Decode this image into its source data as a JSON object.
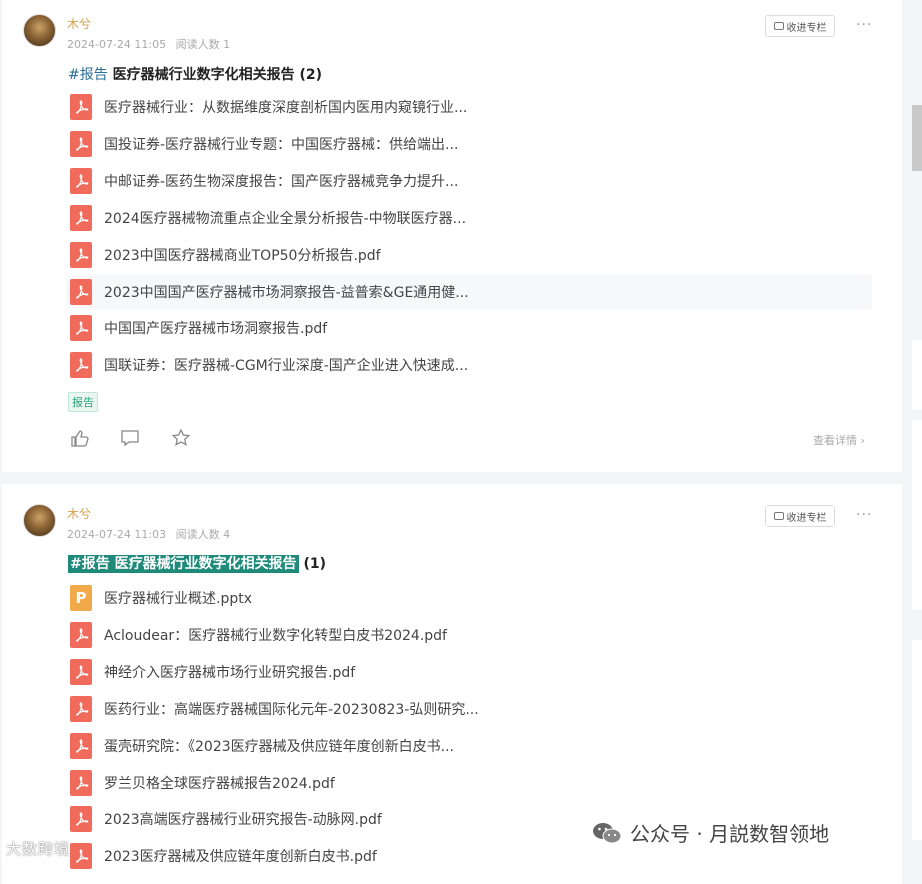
{
  "posts": [
    {
      "author": "木兮",
      "date": "2024-07-24 11:05",
      "reads": "阅读人数 1",
      "collect_label": "收进专栏",
      "more": "···",
      "title_tag": "#报告",
      "title_text": "医疗器械行业数字化相关报告",
      "title_suffix": "(2)",
      "files": [
        {
          "name": "医疗器械行业：从数据维度深度剖析国内医用内窥镜行业...",
          "type": "pdf"
        },
        {
          "name": "国投证券-医疗器械行业专题：中国医疗器械：供给端出...",
          "type": "pdf"
        },
        {
          "name": "中邮证券-医药生物深度报告：国产医疗器械竞争力提升...",
          "type": "pdf"
        },
        {
          "name": "2024医疗器械物流重点企业全景分析报告-中物联医疗器...",
          "type": "pdf"
        },
        {
          "name": "2023中国医疗器械商业TOP50分析报告.pdf",
          "type": "pdf"
        },
        {
          "name": "2023中国国产医疗器械市场洞察报告-益普索&GE通用健...",
          "type": "pdf"
        },
        {
          "name": "中国国产医疗器械市场洞察报告.pdf",
          "type": "pdf"
        },
        {
          "name": "国联证券：医疗器械-CGM行业深度-国产企业进入快速成...",
          "type": "pdf"
        }
      ],
      "tag_label": "报告",
      "detail_label": "查看详情"
    },
    {
      "author": "木兮",
      "date": "2024-07-24 11:03",
      "reads": "阅读人数 4",
      "collect_label": "收进专栏",
      "more": "···",
      "title_tag": "#报告",
      "title_text": "医疗器械行业数字化相关报告",
      "title_suffix": "(1)",
      "files": [
        {
          "name": "医疗器械行业概述.pptx",
          "type": "ppt"
        },
        {
          "name": "Acloudear：医疗器械行业数字化转型白皮书2024.pdf",
          "type": "pdf"
        },
        {
          "name": "神经介入医疗器械市场行业研究报告.pdf",
          "type": "pdf"
        },
        {
          "name": "医药行业：高端医疗器械国际化元年-20230823-弘则研究...",
          "type": "pdf"
        },
        {
          "name": "蛋壳研究院：《2023医疗器械及供应链年度创新白皮书...",
          "type": "pdf"
        },
        {
          "name": "罗兰贝格全球医疗器械报告2024.pdf",
          "type": "pdf"
        },
        {
          "name": "2023高端医疗器械行业研究报告-动脉网.pdf",
          "type": "pdf"
        },
        {
          "name": "2023医疗器械及供应链年度创新白皮书.pdf",
          "type": "pdf"
        }
      ]
    }
  ],
  "ppt_letter": "P",
  "watermark": "公众号 · 月説数智领地",
  "corner_text": "大数跨境"
}
